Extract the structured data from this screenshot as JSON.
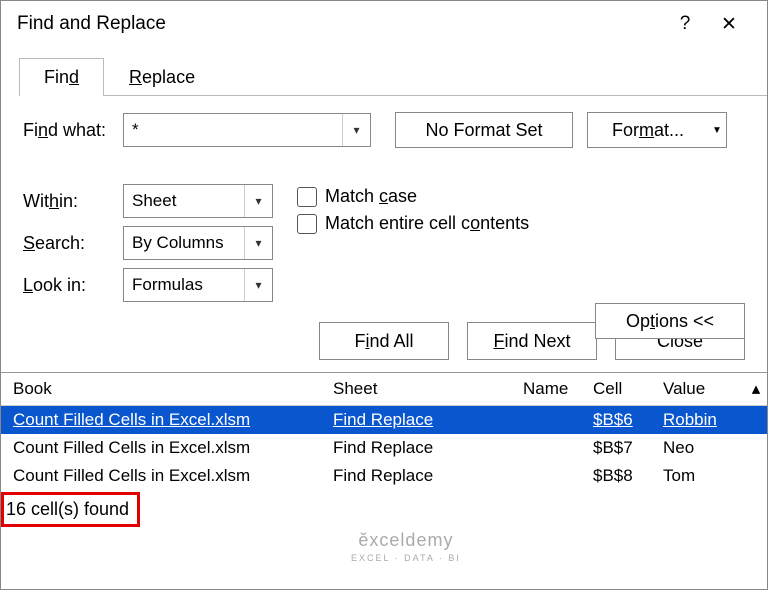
{
  "title": "Find and Replace",
  "help": "?",
  "close_x": "✕",
  "tabs": {
    "find": "Find",
    "replace": "Replace"
  },
  "find_what_label": "Find what:",
  "find_what_value": "*",
  "no_format": "No Format Set",
  "format_btn": "Format...",
  "within_label": "Within:",
  "within_value": "Sheet",
  "search_label": "Search:",
  "search_value": "By Columns",
  "lookin_label": "Look in:",
  "lookin_value": "Formulas",
  "match_case": "Match case",
  "match_entire": "Match entire cell contents",
  "options_btn": "Options <<",
  "find_all": "Find All",
  "find_next": "Find Next",
  "close_btn": "Close",
  "headers": {
    "book": "Book",
    "sheet": "Sheet",
    "name": "Name",
    "cell": "Cell",
    "value": "Value"
  },
  "rows": [
    {
      "book": "Count Filled Cells in Excel.xlsm",
      "sheet": "Find Replace",
      "name": "",
      "cell": "$B$6",
      "value": "Robbin"
    },
    {
      "book": "Count Filled Cells in Excel.xlsm",
      "sheet": "Find Replace",
      "name": "",
      "cell": "$B$7",
      "value": "Neo"
    },
    {
      "book": "Count Filled Cells in Excel.xlsm",
      "sheet": "Find Replace",
      "name": "",
      "cell": "$B$8",
      "value": "Tom"
    }
  ],
  "status": "16 cell(s) found",
  "watermark": "exceldemy"
}
